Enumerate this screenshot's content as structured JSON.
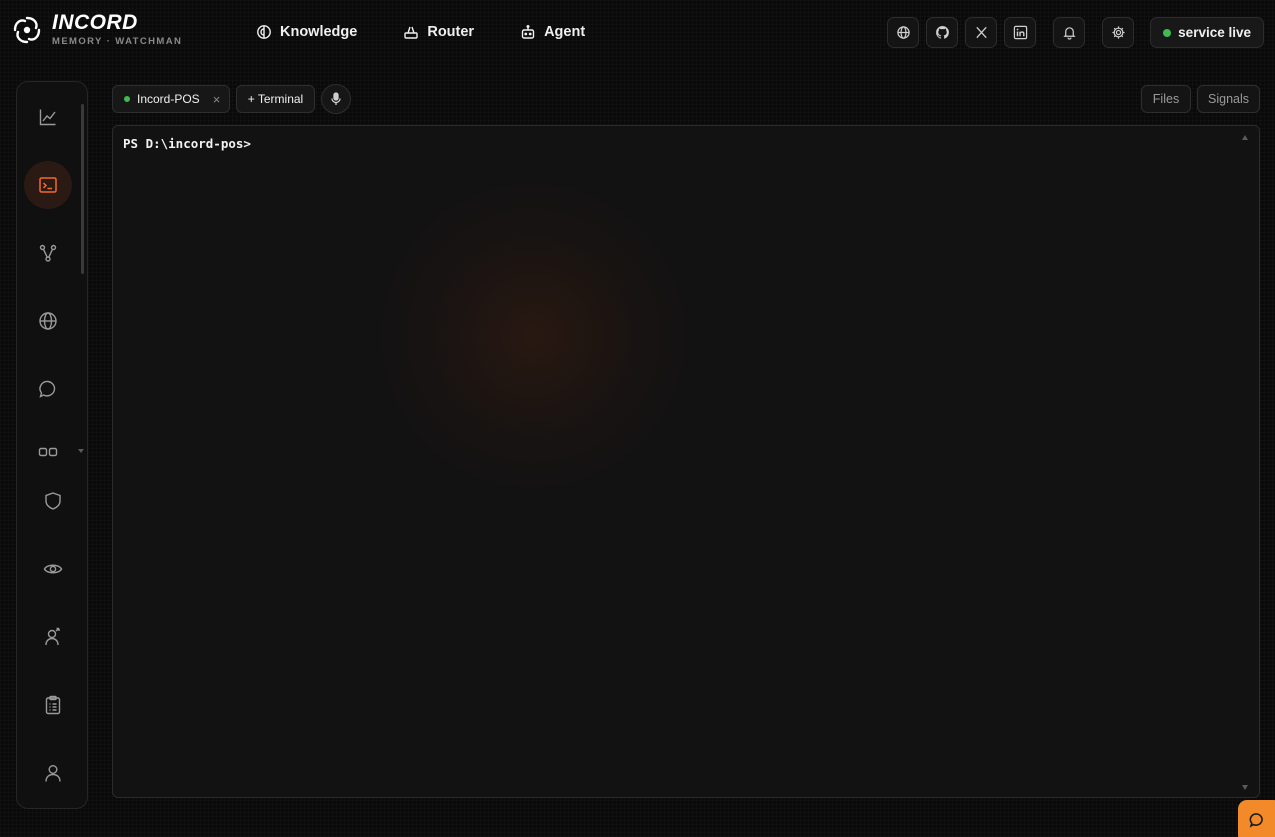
{
  "brand": {
    "name": "INCORD",
    "subtitle": "MEMORY · WATCHMAN",
    "logo_icon": "swirl-logo-icon"
  },
  "nav": [
    {
      "label": "Knowledge",
      "icon": "brain-icon"
    },
    {
      "label": "Router",
      "icon": "router-icon"
    },
    {
      "label": "Agent",
      "icon": "robot-icon"
    }
  ],
  "header_actions": [
    {
      "icon": "globe-icon"
    },
    {
      "icon": "github-icon"
    },
    {
      "icon": "x-twitter-icon"
    },
    {
      "icon": "linkedin-icon"
    },
    {
      "icon": "bell-icon"
    },
    {
      "icon": "gear-icon"
    }
  ],
  "status": {
    "label": "service live",
    "color": "#3fb950"
  },
  "sidebar": {
    "items": [
      {
        "icon": "chart-line-icon",
        "active": false
      },
      {
        "icon": "terminal-icon",
        "active": true
      },
      {
        "icon": "branch-icon",
        "active": false
      },
      {
        "icon": "globe-icon",
        "active": false
      },
      {
        "icon": "chat-bubble-icon",
        "active": false
      },
      {
        "icon": "grid-icon",
        "active": false
      },
      {
        "icon": "shield-icon",
        "active": false
      },
      {
        "icon": "eye-icon",
        "active": false
      },
      {
        "icon": "user-plus-icon",
        "active": false
      },
      {
        "icon": "clipboard-icon",
        "active": false
      },
      {
        "icon": "user-icon",
        "active": false
      }
    ]
  },
  "tabs": {
    "session": {
      "label": "Incord-POS",
      "close": "×",
      "status_color": "#3fb950"
    },
    "new_terminal": "+ Terminal",
    "mic_icon": "microphone-icon"
  },
  "panel_buttons": {
    "files": "Files",
    "signals": "Signals"
  },
  "terminal": {
    "prompt": "PS D:\\incord-pos>"
  },
  "chat_fab": {
    "icon": "chat-icon",
    "color": "#f28a2a"
  },
  "colors": {
    "accent": "#f26a2a",
    "background": "#0a0a0a"
  }
}
